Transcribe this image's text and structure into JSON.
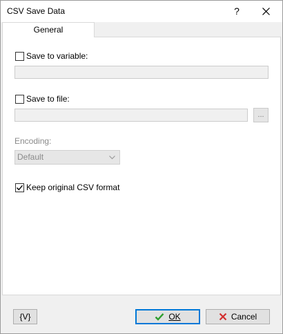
{
  "window": {
    "title": "CSV Save Data",
    "help_label": "?"
  },
  "tabs": [
    {
      "label": "General",
      "selected": true
    }
  ],
  "form": {
    "save_to_variable": {
      "label": "Save to variable:",
      "checked": false,
      "value": ""
    },
    "save_to_file": {
      "label": "Save to file:",
      "checked": false,
      "value": "",
      "browse_label": "..."
    },
    "encoding": {
      "label": "Encoding:",
      "value": "Default"
    },
    "keep_format": {
      "label": "Keep original CSV format",
      "checked": true
    }
  },
  "footer": {
    "variables_label": "{V}",
    "ok_label": "OK",
    "cancel_label": "Cancel"
  },
  "colors": {
    "accent": "#0078d7",
    "ok_icon": "#2e9e2e",
    "cancel_icon": "#d32f2f"
  },
  "icons": [
    "close-icon",
    "check-icon",
    "cross-icon",
    "chevron-down-icon"
  ]
}
